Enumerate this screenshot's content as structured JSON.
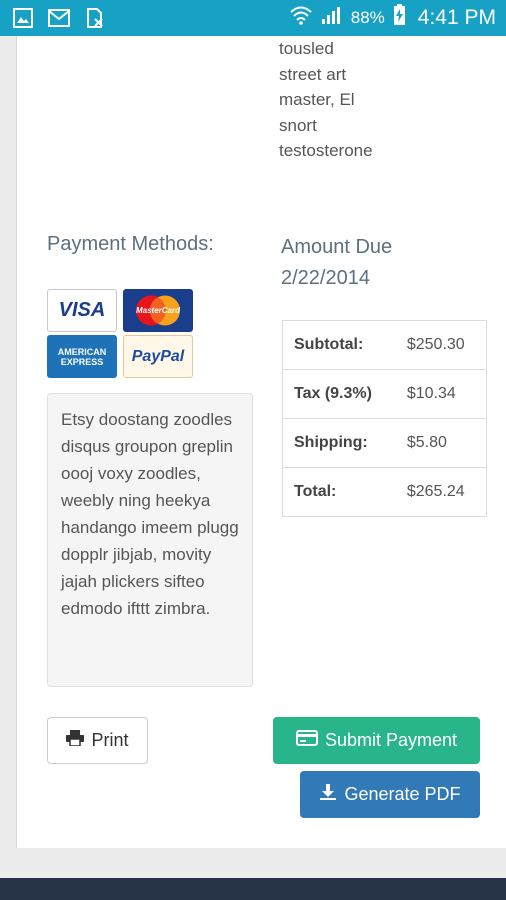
{
  "status_bar": {
    "battery_text": "88%",
    "time": "4:41 PM",
    "icons": [
      "gallery-icon",
      "mail-icon",
      "sim-card-icon",
      "wifi-icon",
      "signal-icon",
      "battery-charging-icon"
    ]
  },
  "description": {
    "lines": [
      "tousled",
      "street art",
      "master, El",
      "snort",
      "testosterone"
    ]
  },
  "payment_methods": {
    "label": "Payment Methods:",
    "cards": [
      {
        "name": "VISA",
        "icon": "visa-logo"
      },
      {
        "name": "MasterCard",
        "icon": "mastercard-logo"
      },
      {
        "name": "AMERICAN EXPRESS",
        "icon": "amex-logo"
      },
      {
        "name": "PayPal",
        "icon": "paypal-logo"
      }
    ],
    "notes": "Etsy doostang zoodles disqus groupon greplin oooj voxy zoodles, weebly ning heekya handango imeem plugg dopplr jibjab, movity jajah plickers sifteo edmodo ifttt zimbra."
  },
  "amount_due": {
    "label": "Amount Due",
    "date": "2/22/2014",
    "rows": [
      {
        "label": "Subtotal:",
        "value": "$250.30"
      },
      {
        "label": "Tax (9.3%)",
        "value": "$10.34"
      },
      {
        "label": "Shipping:",
        "value": "$5.80"
      },
      {
        "label": "Total:",
        "value": "$265.24"
      }
    ]
  },
  "actions": {
    "print_label": "Print",
    "submit_label": "Submit Payment",
    "pdf_label": "Generate PDF"
  },
  "colors": {
    "status_bar": "#17a1c4",
    "submit": "#27b589",
    "pdf": "#3279b7",
    "bottom_bar": "#253247"
  }
}
